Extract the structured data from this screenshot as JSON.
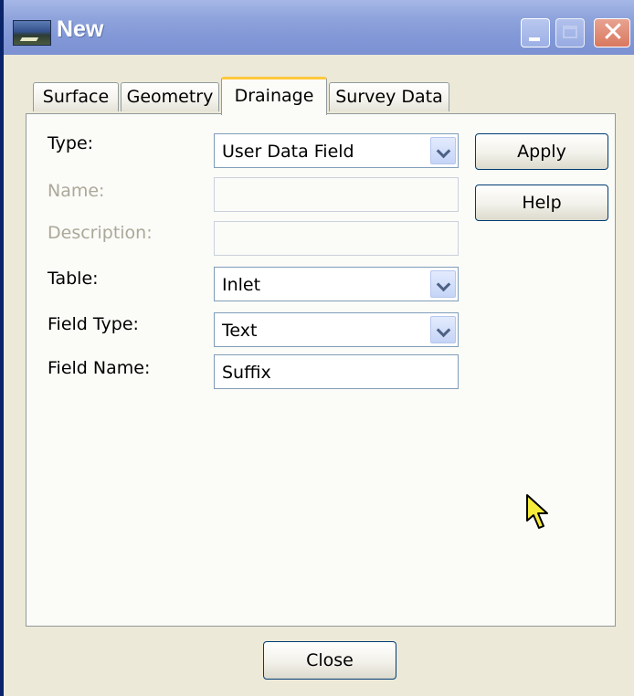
{
  "window": {
    "title": "New"
  },
  "title_buttons": {
    "minimize_icon": "minimize-icon",
    "maximize_icon": "maximize-icon",
    "close_glyph": "✕"
  },
  "tabs": [
    {
      "label": "Surface",
      "active": false
    },
    {
      "label": "Geometry",
      "active": false
    },
    {
      "label": "Drainage",
      "active": true
    },
    {
      "label": "Survey Data",
      "active": false
    }
  ],
  "form": {
    "type": {
      "label": "Type:",
      "value": "User Data Field"
    },
    "name": {
      "label": "Name:",
      "value": "",
      "disabled": true
    },
    "description": {
      "label": "Description:",
      "value": "",
      "disabled": true
    },
    "table": {
      "label": "Table:",
      "value": "Inlet"
    },
    "field_type": {
      "label": "Field Type:",
      "value": "Text"
    },
    "field_name": {
      "label": "Field Name:",
      "value": "Suffix"
    }
  },
  "buttons": {
    "apply": "Apply",
    "help": "Help",
    "close": "Close"
  },
  "colors": {
    "titlebar": "#8ea3dc",
    "active_tab_accent": "#ffc83c",
    "button_border": "#003c74",
    "disabled_text": "#aca899"
  },
  "icons": {
    "app": "app-icon",
    "dropdown": "chevron-down-icon",
    "cursor": "mouse-pointer-icon"
  }
}
